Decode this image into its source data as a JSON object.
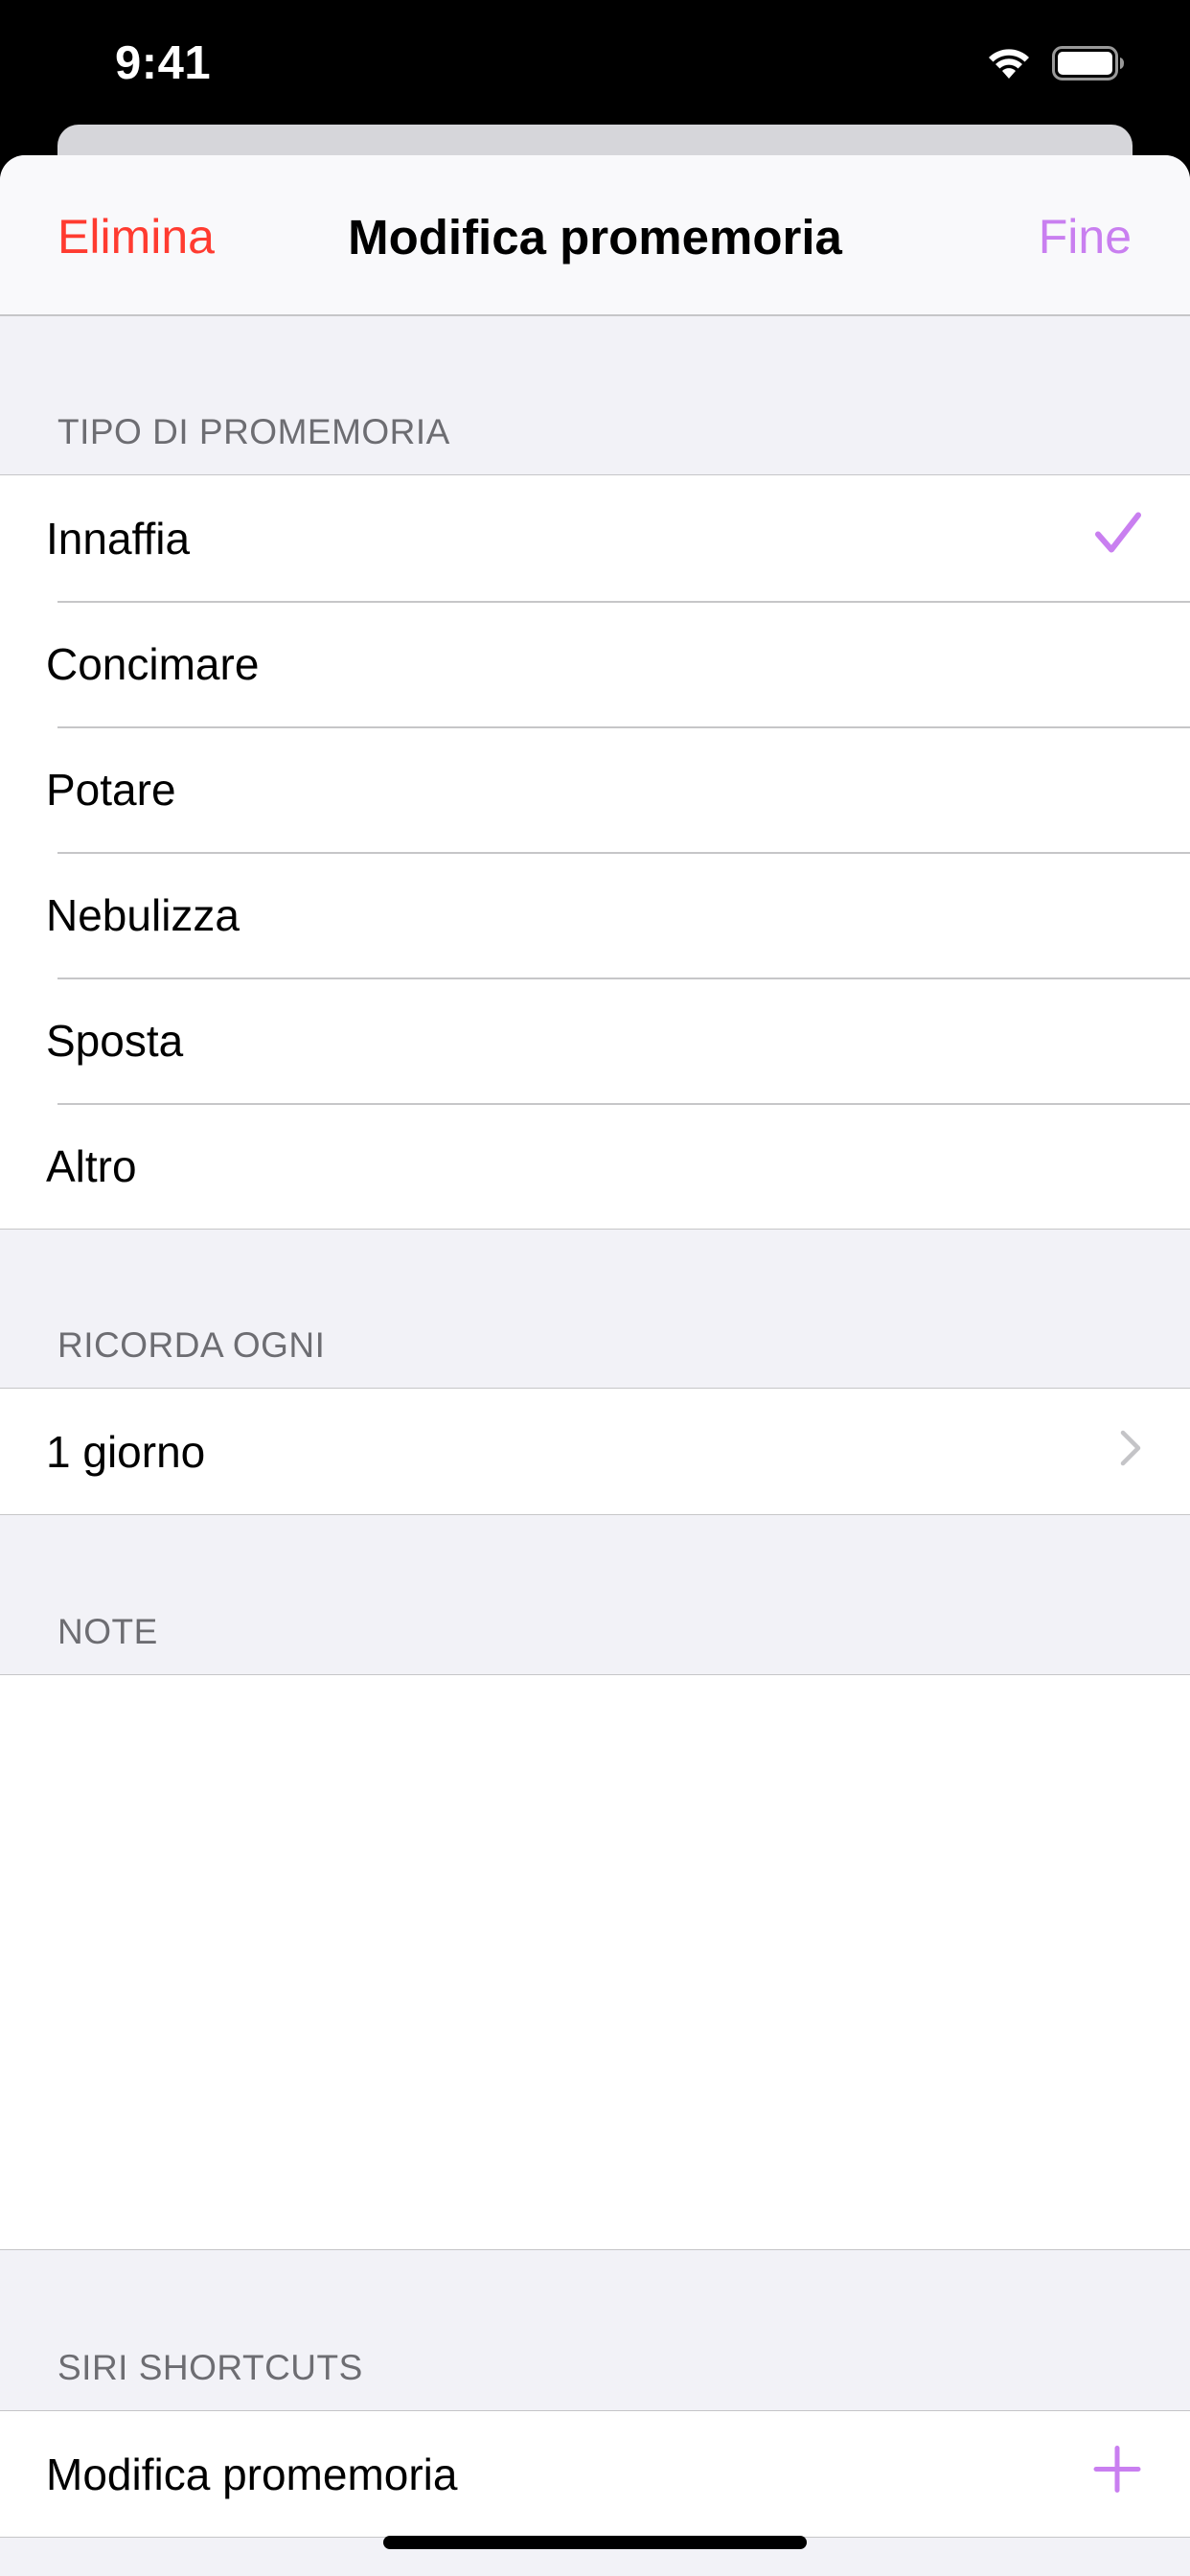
{
  "status_bar": {
    "time": "9:41"
  },
  "nav": {
    "left_label": "Elimina",
    "title": "Modifica promemoria",
    "right_label": "Fine",
    "left_color": "#ff3b30",
    "accent_color": "#c97ff0"
  },
  "reminder_type": {
    "header": "TIPO DI PROMEMORIA",
    "selected": "Innaffia",
    "options": [
      "Innaffia",
      "Concimare",
      "Potare",
      "Nebulizza",
      "Sposta",
      "Altro"
    ]
  },
  "repeat": {
    "header": "RICORDA OGNI",
    "value": "1 giorno"
  },
  "notes": {
    "header": "NOTE",
    "value": ""
  },
  "siri": {
    "header": "SIRI SHORTCUTS",
    "item_label": "Modifica promemoria"
  }
}
